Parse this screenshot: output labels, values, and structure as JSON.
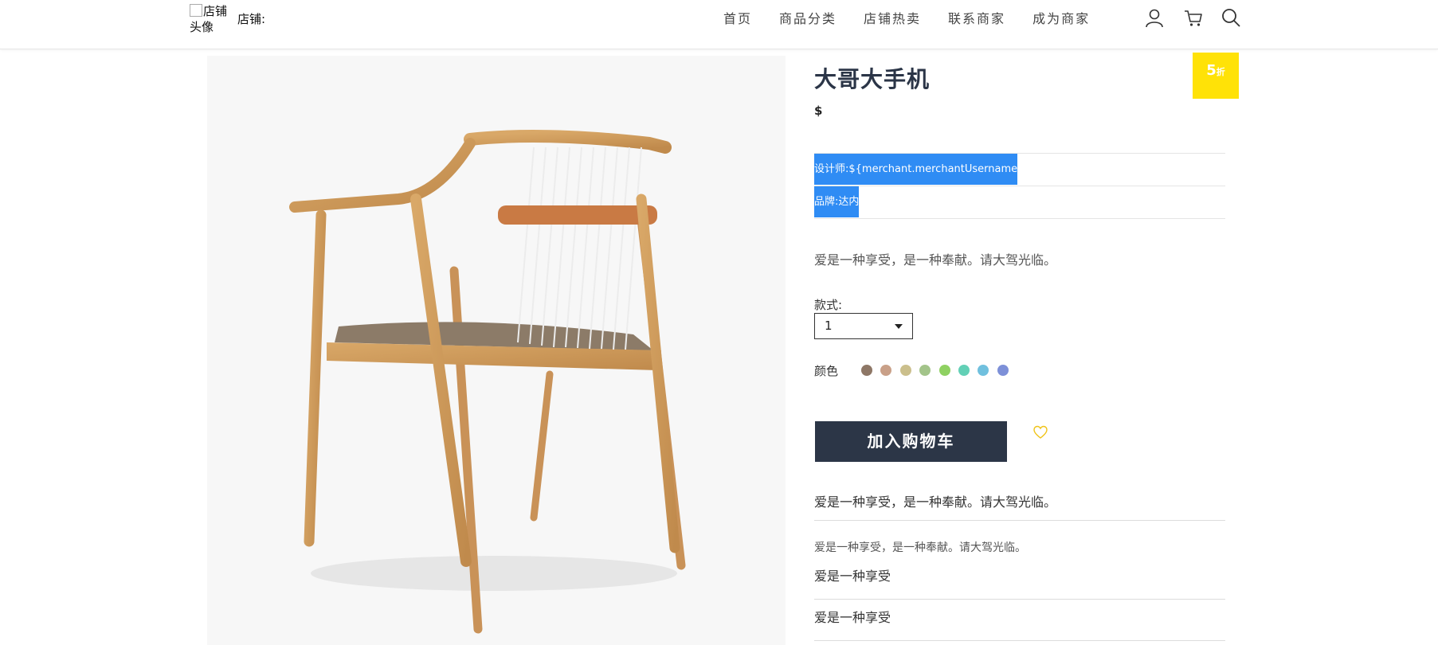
{
  "header": {
    "avatar_alt": "店铺头像",
    "store_label": "店铺:",
    "nav": [
      "首页",
      "商品分类",
      "店铺热卖",
      "联系商家",
      "成为商家"
    ],
    "icons": [
      "user-icon",
      "cart-icon",
      "search-icon"
    ],
    "accent": "#f5e21a"
  },
  "product": {
    "title": "大哥大手机",
    "discount_value": "5",
    "discount_unit": "折",
    "price": "$",
    "designer": "设计师:${merchant.merchantUsername",
    "brand": "品牌:达内",
    "description": "爱是一种享受，是一种奉献。请大驾光临。",
    "style_label": "款式:",
    "style_value": "1",
    "color_label": "颜色",
    "colors": [
      "#8e7766",
      "#c9a088",
      "#cbbf8c",
      "#a3c48a",
      "#8fd162",
      "#62d0b6",
      "#70c0de",
      "#7d90d8"
    ],
    "add_to_cart": "加入购物车",
    "fav_icon": "heart-icon",
    "desc_main": "爱是一种享受，是一种奉献。请大驾光临。",
    "desc_small": "爱是一种享受，是一种奉献。请大驾光临。",
    "items": [
      "爱是一种享受",
      "爱是一种享受"
    ]
  }
}
